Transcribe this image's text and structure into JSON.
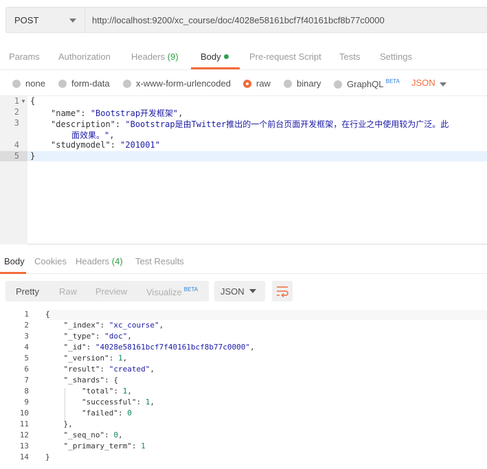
{
  "request": {
    "method": "POST",
    "url": "http://localhost:9200/xc_course/doc/4028e58161bcf7f40161bcf8b77c0000"
  },
  "request_tabs": {
    "params": "Params",
    "authorization": "Authorization",
    "headers": "Headers",
    "headers_count": "(9)",
    "body": "Body",
    "prerequest": "Pre-request Script",
    "tests": "Tests",
    "settings": "Settings"
  },
  "body_modes": {
    "none": "none",
    "form_data": "form-data",
    "urlencoded": "x-www-form-urlencoded",
    "raw": "raw",
    "binary": "binary",
    "graphql": "GraphQL",
    "beta": "BETA",
    "format": "JSON"
  },
  "request_body": {
    "line_numbers": [
      "1",
      "2",
      "3",
      "",
      "4",
      "5"
    ],
    "l1": "{",
    "name_key": "\"name\"",
    "name_val": "\"Bootstrap开发框架\"",
    "desc_key": "\"description\"",
    "desc_val": "\"Bootstrap是由Twitter推出的一个前台页面开发框架，在行业之中使用较为广泛。此",
    "desc_cont": "面效果。\"",
    "study_key": "\"studymodel\"",
    "study_val": "\"201001\"",
    "l5": "}"
  },
  "response_tabs": {
    "body": "Body",
    "cookies": "Cookies",
    "headers": "Headers",
    "headers_count": "(4)",
    "test_results": "Test Results"
  },
  "response_view": {
    "pretty": "Pretty",
    "raw": "Raw",
    "preview": "Preview",
    "visualize": "Visualize",
    "beta": "BETA",
    "format": "JSON"
  },
  "response_body": {
    "line_numbers": [
      "1",
      "2",
      "3",
      "4",
      "5",
      "6",
      "7",
      "8",
      "9",
      "10",
      "11",
      "12",
      "13",
      "14"
    ],
    "lines": [
      "{",
      "    \"_index\": \"xc_course\",",
      "    \"_type\": \"doc\",",
      "    \"_id\": \"4028e58161bcf7f40161bcf8b77c0000\",",
      "    \"_version\": 1,",
      "    \"result\": \"created\",",
      "    \"_shards\": {",
      "        \"total\": 1,",
      "        \"successful\": 1,",
      "        \"failed\": 0",
      "    },",
      "    \"_seq_no\": 0,",
      "    \"_primary_term\": 1",
      "}"
    ]
  }
}
